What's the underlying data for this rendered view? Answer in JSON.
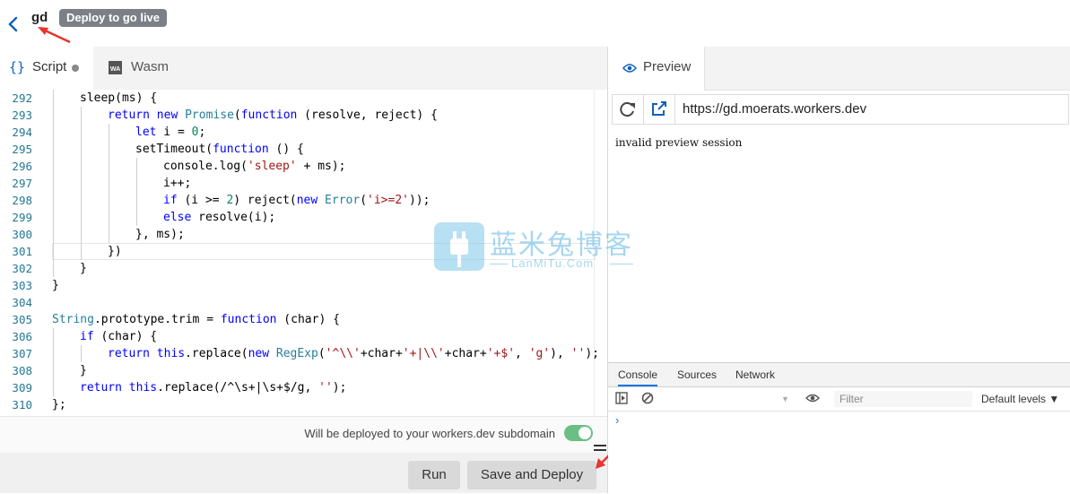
{
  "header": {
    "worker_name": "gd",
    "badge": "Deploy to go live"
  },
  "editor": {
    "tabs": [
      {
        "label": "Script",
        "icon": "curly-braces-icon",
        "modified": true
      },
      {
        "label": "Wasm",
        "icon": "wasm-icon"
      }
    ],
    "deploy_note": "Will be deployed to your workers.dev subdomain",
    "toggle_on": true,
    "run_label": "Run",
    "deploy_label": "Save and Deploy"
  },
  "code": {
    "lines": [
      {
        "n": "292",
        "indent": 1,
        "text": "sleep(ms) {"
      },
      {
        "n": "293",
        "indent": 2,
        "text": "return new Promise(function (resolve, reject) {"
      },
      {
        "n": "294",
        "indent": 3,
        "text": "let i = 0;"
      },
      {
        "n": "295",
        "indent": 3,
        "text": "setTimeout(function () {"
      },
      {
        "n": "296",
        "indent": 4,
        "text": "console.log('sleep' + ms);"
      },
      {
        "n": "297",
        "indent": 4,
        "text": "i++;"
      },
      {
        "n": "298",
        "indent": 4,
        "text": "if (i >= 2) reject(new Error('i>=2'));"
      },
      {
        "n": "299",
        "indent": 4,
        "text": "else resolve(i);"
      },
      {
        "n": "300",
        "indent": 3,
        "text": "}, ms);"
      },
      {
        "n": "301",
        "indent": 2,
        "text": "})"
      },
      {
        "n": "302",
        "indent": 1,
        "text": "}"
      },
      {
        "n": "303",
        "indent": 0,
        "text": "}"
      },
      {
        "n": "304",
        "indent": 0,
        "text": ""
      },
      {
        "n": "305",
        "indent": 0,
        "text": "String.prototype.trim = function (char) {"
      },
      {
        "n": "306",
        "indent": 1,
        "text": "if (char) {"
      },
      {
        "n": "307",
        "indent": 2,
        "text": "return this.replace(new RegExp('^\\\\'+char+'+|\\\\'+char+'+$', 'g'), '');"
      },
      {
        "n": "308",
        "indent": 1,
        "text": "}"
      },
      {
        "n": "309",
        "indent": 1,
        "text": "return this.replace(/^\\s+|\\s+$/g, '');"
      },
      {
        "n": "310",
        "indent": 0,
        "text": "};"
      }
    ]
  },
  "preview": {
    "tab_label": "Preview",
    "url": "https://gd.moerats.workers.dev",
    "body_text": "invalid preview session"
  },
  "watermark": {
    "cn": "蓝米兔博客",
    "en": "LanMiTu.Com"
  },
  "devtools": {
    "tabs": [
      "Console",
      "Sources",
      "Network"
    ],
    "filter_placeholder": "Filter",
    "levels_label": "Default levels ▼",
    "prompt": "›"
  },
  "colors": {
    "accent": "#0f62b8",
    "toggle": "#6bbf84",
    "annotation_arrow": "#e8342b"
  }
}
